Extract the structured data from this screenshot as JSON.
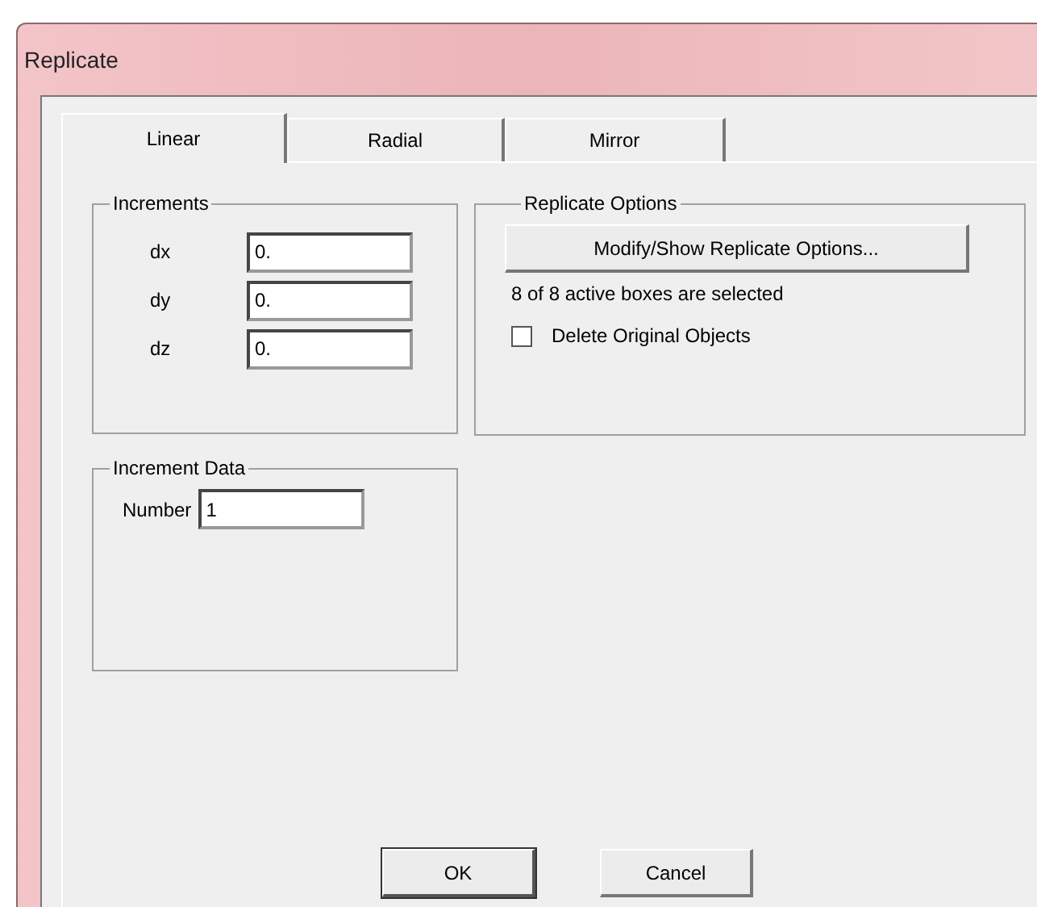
{
  "window": {
    "title": "Replicate"
  },
  "tabs": [
    {
      "label": "Linear",
      "selected": true
    },
    {
      "label": "Radial",
      "selected": false
    },
    {
      "label": "Mirror",
      "selected": false
    }
  ],
  "increments": {
    "title": "Increments",
    "fields": [
      {
        "label": "dx",
        "value": "0."
      },
      {
        "label": "dy",
        "value": "0."
      },
      {
        "label": "dz",
        "value": "0."
      }
    ]
  },
  "replicate_options": {
    "title": "Replicate Options",
    "button": "Modify/Show Replicate Options...",
    "status": "8 of 8 active boxes are selected",
    "delete_original": {
      "label": "Delete Original Objects",
      "checked": false
    }
  },
  "increment_data": {
    "title": "Increment Data",
    "number_label": "Number",
    "number_value": "1"
  },
  "buttons": [
    {
      "label": "OK",
      "default": true
    },
    {
      "label": "Cancel",
      "default": false
    }
  ]
}
